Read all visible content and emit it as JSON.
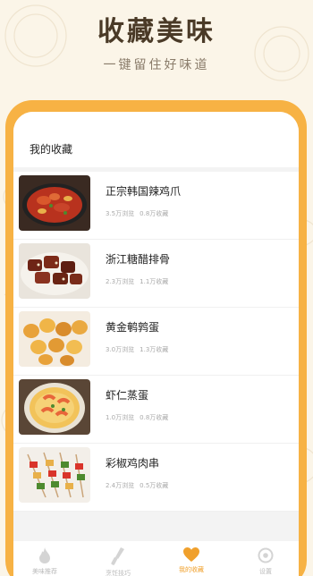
{
  "promo": {
    "title": "收藏美味",
    "subtitle": "一键留住好味道"
  },
  "screen": {
    "title": "我的收藏"
  },
  "favorites": [
    {
      "name": "正宗韩国辣鸡爪",
      "views": "3.5万浏览",
      "saves": "0.8万收藏",
      "image": "spicy-chicken-feet-photo"
    },
    {
      "name": "浙江糖醋排骨",
      "views": "2.3万浏览",
      "saves": "1.1万收藏",
      "image": "sweet-sour-ribs-photo"
    },
    {
      "name": "黄金鹌鹑蛋",
      "views": "3.0万浏览",
      "saves": "1.3万收藏",
      "image": "golden-quail-eggs-photo"
    },
    {
      "name": "虾仁蒸蛋",
      "views": "1.0万浏览",
      "saves": "0.8万收藏",
      "image": "shrimp-steamed-egg-photo"
    },
    {
      "name": "彩椒鸡肉串",
      "views": "2.4万浏览",
      "saves": "0.5万收藏",
      "image": "pepper-chicken-skewers-photo"
    }
  ],
  "tabbar": {
    "tabs": [
      {
        "label": "美味推荐",
        "icon": "fire-icon"
      },
      {
        "label": "烹饪技巧",
        "icon": "spatula-icon"
      },
      {
        "label": "我的收藏",
        "icon": "heart-icon"
      },
      {
        "label": "设置",
        "icon": "gear-icon"
      }
    ]
  },
  "colors": {
    "accent": "#f7b244",
    "background": "#fbf5e8",
    "title": "#4a3a27"
  }
}
